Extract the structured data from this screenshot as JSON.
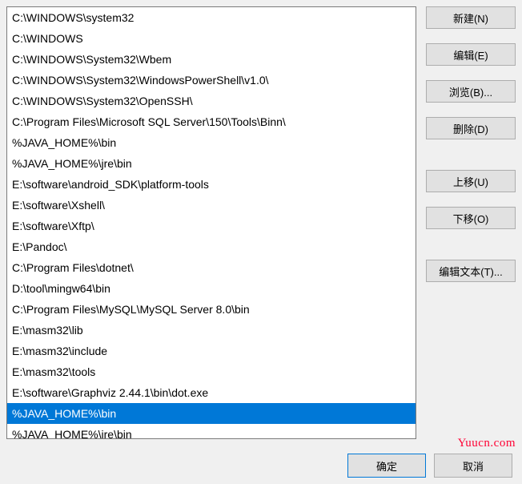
{
  "list": {
    "items": [
      "C:\\WINDOWS\\system32",
      "C:\\WINDOWS",
      "C:\\WINDOWS\\System32\\Wbem",
      "C:\\WINDOWS\\System32\\WindowsPowerShell\\v1.0\\",
      "C:\\WINDOWS\\System32\\OpenSSH\\",
      "C:\\Program Files\\Microsoft SQL Server\\150\\Tools\\Binn\\",
      "%JAVA_HOME%\\bin",
      "%JAVA_HOME%\\jre\\bin",
      "E:\\software\\android_SDK\\platform-tools",
      "E:\\software\\Xshell\\",
      "E:\\software\\Xftp\\",
      "E:\\Pandoc\\",
      "C:\\Program Files\\dotnet\\",
      "D:\\tool\\mingw64\\bin",
      "C:\\Program Files\\MySQL\\MySQL Server 8.0\\bin",
      "E:\\masm32\\lib",
      "E:\\masm32\\include",
      "E:\\masm32\\tools",
      "E:\\software\\Graphviz 2.44.1\\bin\\dot.exe",
      "%JAVA_HOME%\\bin",
      "%JAVA_HOME%\\jre\\bin"
    ],
    "selected_index": 19
  },
  "buttons": {
    "new": "新建(N)",
    "edit": "编辑(E)",
    "browse": "浏览(B)...",
    "delete": "删除(D)",
    "move_up": "上移(U)",
    "move_down": "下移(O)",
    "edit_text": "编辑文本(T)...",
    "ok": "确定",
    "cancel": "取消"
  },
  "watermark": "Yuucn.com"
}
